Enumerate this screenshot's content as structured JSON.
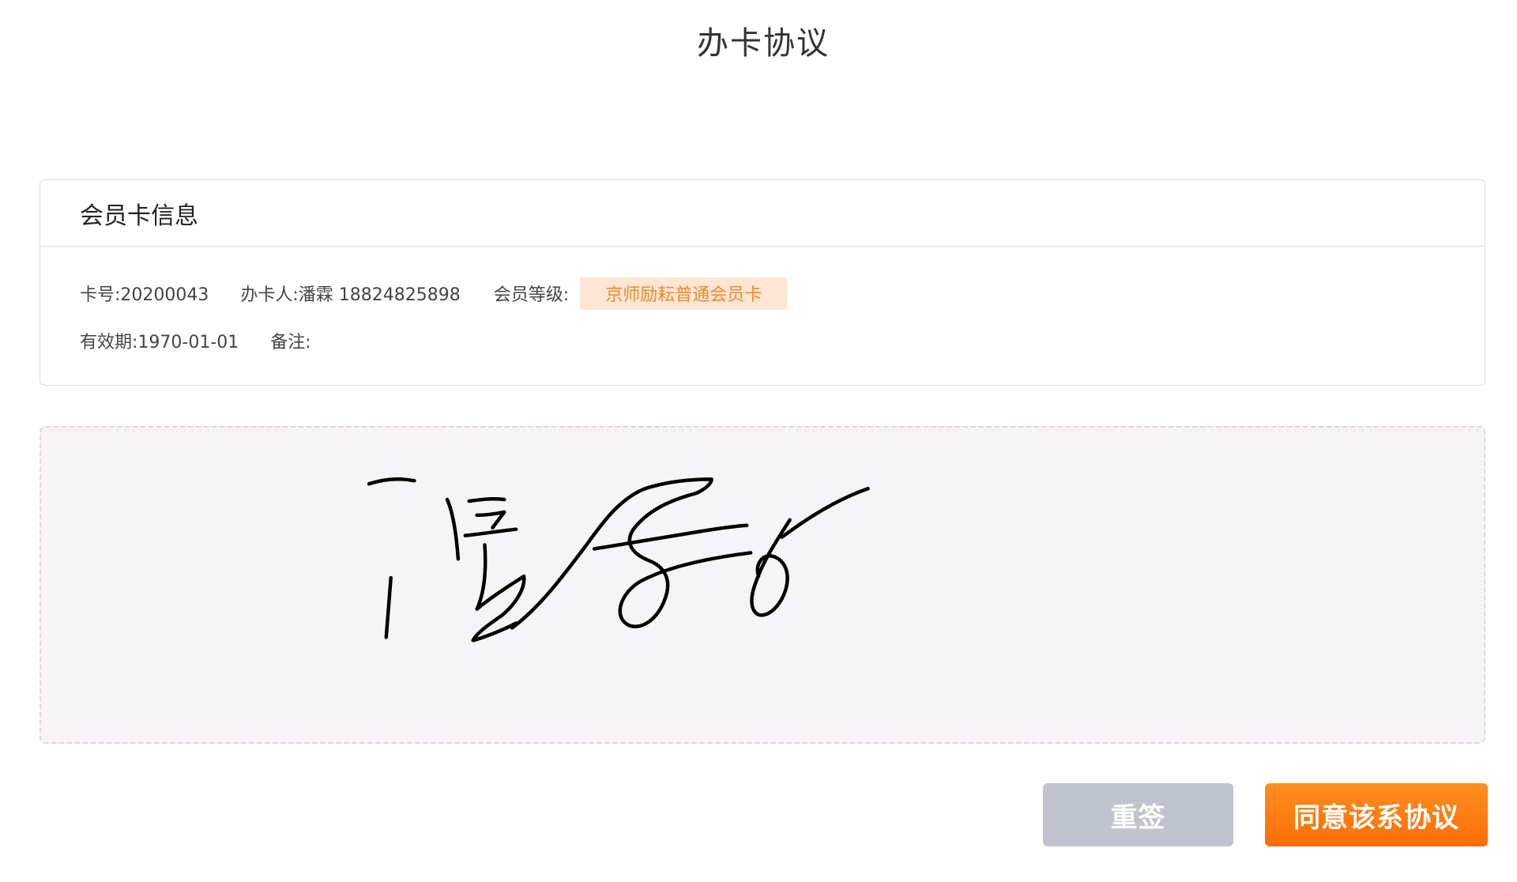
{
  "page": {
    "title": "办卡协议"
  },
  "card": {
    "header": "会员卡信息",
    "card_no": "卡号:20200043",
    "applicant": "办卡人:潘霖 18824825898",
    "level_label": "会员等级:",
    "level_value": "京师励耘普通会员卡",
    "validity": "有效期:1970-01-01",
    "remark": "备注:"
  },
  "signature": {
    "has_signature": true,
    "stroke_color": "#000000"
  },
  "actions": {
    "resign_label": "重签",
    "agree_label": "同意该系协议"
  },
  "colors": {
    "accent": "#fb7b12",
    "tag_bg": "#fde6d4",
    "tag_text": "#f08a2c",
    "resign_bg": "#c0c4cf",
    "pad_bg": "#f7f3f6"
  }
}
